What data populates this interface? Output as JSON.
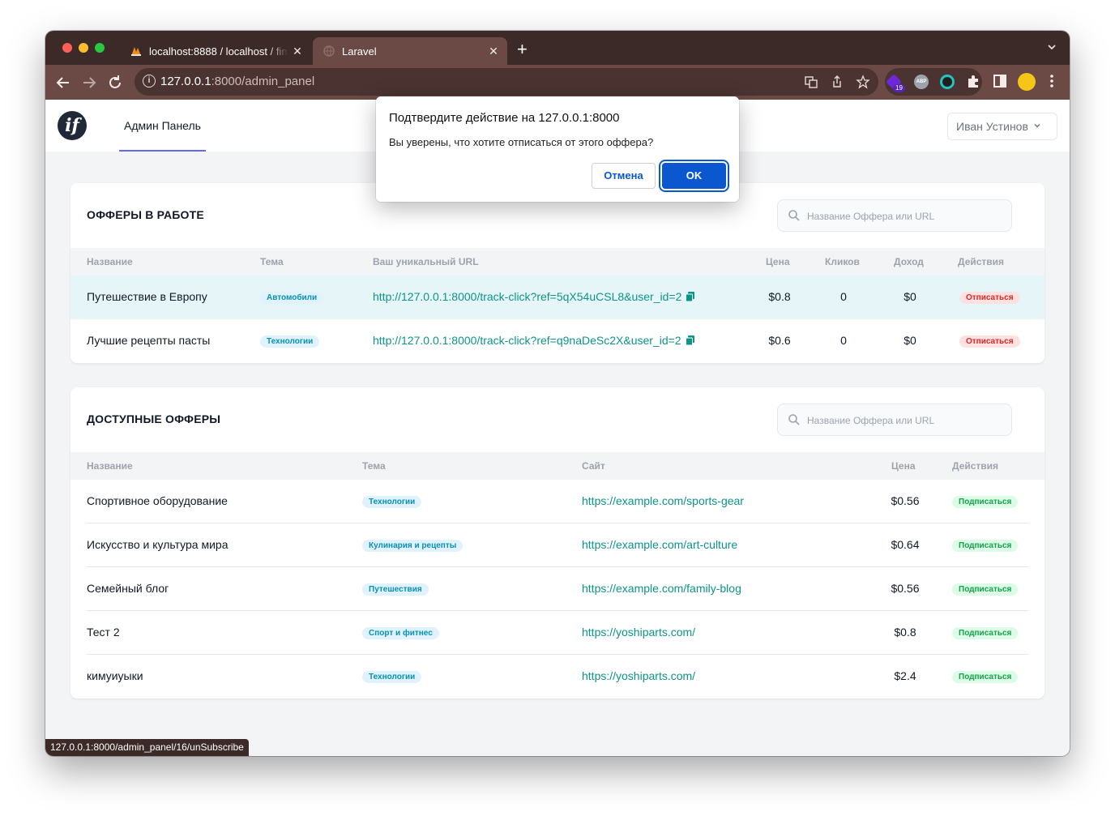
{
  "browser": {
    "tabs": [
      {
        "title": "localhost:8888 / localhost / fin",
        "close": "✕"
      },
      {
        "title": "Laravel",
        "close": "✕"
      }
    ],
    "new_tab": "+",
    "address": {
      "host": "127.0.0.1",
      "rest": ":8000/admin_panel"
    },
    "extension_badge": "19",
    "abp_label": "ABP",
    "status_url": "127.0.0.1:8000/admin_panel/16/unSubscribe"
  },
  "header": {
    "logo": "if",
    "nav_admin": "Админ Панель",
    "user": "Иван Устинов"
  },
  "dialog": {
    "title": "Подтвердите действие на 127.0.0.1:8000",
    "message": "Вы уверены, что хотите отписаться от этого оффера?",
    "cancel": "Отмена",
    "ok": "OK"
  },
  "active_offers": {
    "title": "ОФФЕРЫ В РАБОТЕ",
    "search_placeholder": "Название Оффера или URL",
    "columns": [
      "Название",
      "Тема",
      "Ваш уникальный URL",
      "Цена",
      "Кликов",
      "Доход",
      "Действия"
    ],
    "rows": [
      {
        "name": "Путешествие в Европу",
        "topic": "Автомобили",
        "url": "http://127.0.0.1:8000/track-click?ref=5qX54uCSL8&user_id=2",
        "price": "$0.8",
        "clicks": "0",
        "income": "$0",
        "action": "Отписаться"
      },
      {
        "name": "Лучшие рецепты пасты",
        "topic": "Технологии",
        "url": "http://127.0.0.1:8000/track-click?ref=q9naDeSc2X&user_id=2",
        "price": "$0.6",
        "clicks": "0",
        "income": "$0",
        "action": "Отписаться"
      }
    ]
  },
  "available_offers": {
    "title": "ДОСТУПНЫЕ ОФФЕРЫ",
    "search_placeholder": "Название Оффера или URL",
    "columns": [
      "Название",
      "Тема",
      "Сайт",
      "Цена",
      "Действия"
    ],
    "rows": [
      {
        "name": "Спортивное оборудование",
        "topic": "Технологии",
        "site": "https://example.com/sports-gear",
        "price": "$0.56",
        "action": "Подписаться"
      },
      {
        "name": "Искусство и культура мира",
        "topic": "Кулинария и рецепты",
        "site": "https://example.com/art-culture",
        "price": "$0.64",
        "action": "Подписаться"
      },
      {
        "name": "Семейный блог",
        "topic": "Путешествия",
        "site": "https://example.com/family-blog",
        "price": "$0.56",
        "action": "Подписаться"
      },
      {
        "name": "Тест 2",
        "topic": "Спорт и фитнес",
        "site": "https://yoshiparts.com/",
        "price": "$0.8",
        "action": "Подписаться"
      },
      {
        "name": "кимуиуыки",
        "topic": "Технологии",
        "site": "https://yoshiparts.com/",
        "price": "$2.4",
        "action": "Подписаться"
      }
    ]
  },
  "colors": {
    "tabbar": "#3c2a28",
    "toolbar": "#6b4a45",
    "accent_link": "#0d9488",
    "nav_underline": "#6366f1",
    "dialog_button": "#0b57d0"
  }
}
